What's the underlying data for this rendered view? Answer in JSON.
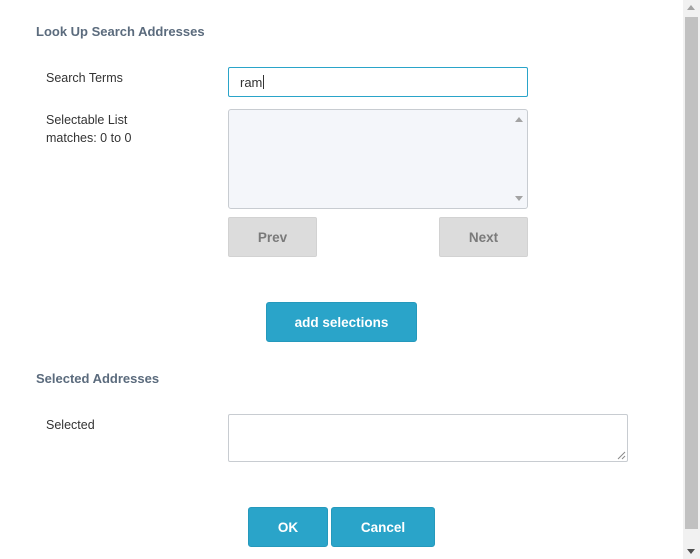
{
  "lookup_section": {
    "title": "Look Up Search Addresses",
    "search_terms_label": "Search Terms",
    "search_value": "ram",
    "selectable_list_label": "Selectable List",
    "matches_label": "matches: 0  to 0",
    "list_items": [],
    "prev_label": "Prev",
    "next_label": "Next",
    "add_selections_label": "add selections"
  },
  "selected_section": {
    "title": "Selected Addresses",
    "selected_label": "Selected",
    "selected_value": ""
  },
  "footer": {
    "ok_label": "OK",
    "cancel_label": "Cancel"
  },
  "colors": {
    "accent": "#2aa4c9",
    "section_title": "#5b6b7d",
    "disabled_button": "#dcdcdc",
    "list_background": "#f4f6fa"
  }
}
